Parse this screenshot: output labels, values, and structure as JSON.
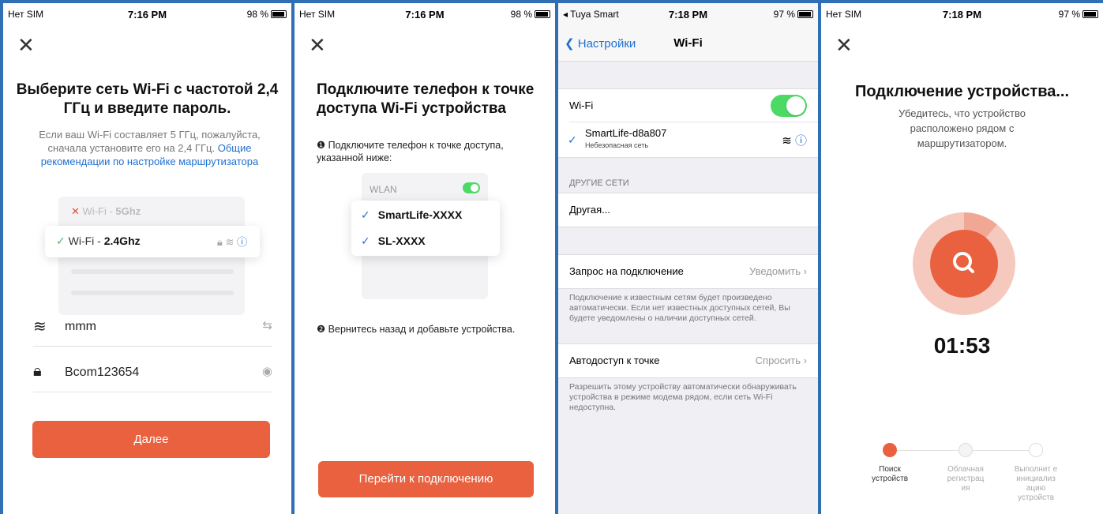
{
  "screen1": {
    "status": {
      "carrier": "Нет SIM",
      "time": "7:16 PM",
      "battery": "98 %"
    },
    "title": "Выберите сеть Wi-Fi с частотой 2,4 ГГц и введите пароль.",
    "hint": "Если ваш Wi-Fi составляет 5 ГГц, пожалуйста, сначала установите его на 2,4 ГГц.",
    "hint_link": "Общие рекомендации по настройке маршрутизатора",
    "net_5g_prefix": "Wi-Fi - ",
    "net_5g_band": "5Ghz",
    "net_24_prefix": "Wi-Fi - ",
    "net_24_band": "2.4Ghz",
    "ssid_value": "mmm",
    "password_value": "Bcom123654",
    "next_button": "Далее"
  },
  "screen2": {
    "status": {
      "carrier": "Нет SIM",
      "time": "7:16 PM",
      "battery": "98 %"
    },
    "title": "Подключите телефон к точке доступа Wi-Fi устройства",
    "step1": "❶ Подключите телефон к точке доступа, указанной ниже:",
    "wlan_label": "WLAN",
    "networks": [
      "SmartLife-XXXX",
      "SL-XXXX"
    ],
    "step2": "❷ Вернитесь назад и добавьте устройства.",
    "connect_button": "Перейти к подключению"
  },
  "screen3": {
    "status": {
      "carrier": "◂ Tuya Smart",
      "time": "7:18 PM",
      "battery": "97 %"
    },
    "back_label": "Настройки",
    "title": "Wi-Fi",
    "wifi_label": "Wi-Fi",
    "connected_name": "SmartLife-d8a807",
    "connected_sub": "Небезопасная сеть",
    "other_header": "ДРУГИЕ СЕТИ",
    "other_item": "Другая...",
    "ask_label": "Запрос на подключение",
    "ask_value": "Уведомить",
    "ask_note": "Подключение к известным сетям будет произведено автоматически. Если нет известных доступных сетей, Вы будете уведомлены о наличии доступных сетей.",
    "hotspot_label": "Автодоступ к точке",
    "hotspot_value": "Спросить",
    "hotspot_note": "Разрешить этому устройству автоматически обнаруживать устройства в режиме модема рядом, если сеть Wi-Fi недоступна."
  },
  "screen4": {
    "status": {
      "carrier": "Нет SIM",
      "time": "7:18 PM",
      "battery": "97 %"
    },
    "title": "Подключение устройства...",
    "subtitle": "Убедитесь, что устройство расположено рядом с маршрутизатором.",
    "timer": "01:53",
    "steps": [
      {
        "label": "Поиск устройств",
        "state": "active"
      },
      {
        "label": "Облачная регистрац ия",
        "state": "pending"
      },
      {
        "label": "Выполнит е инициализ ацию устройств",
        "state": "pending"
      }
    ],
    "progress_fraction": 0.11
  },
  "colors": {
    "accent": "#e9613f",
    "link": "#1f6fd1",
    "toggle_on": "#4cd964"
  }
}
